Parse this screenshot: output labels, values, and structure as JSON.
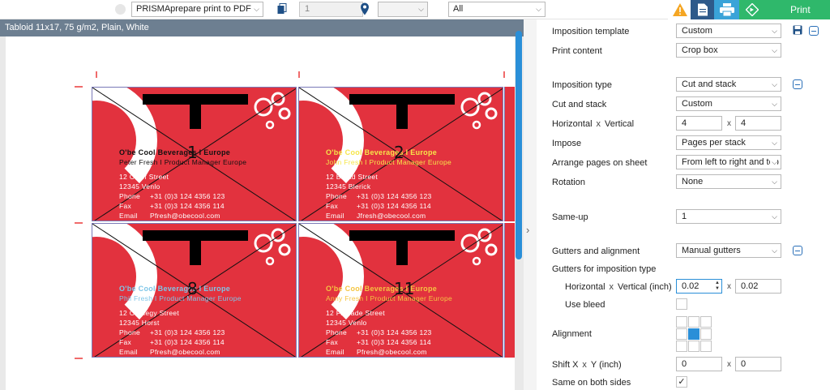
{
  "toolbar": {
    "printer_select": "PRISMAprepare print to PDF",
    "copies_value": "1",
    "location_select": "",
    "filter_select": "All",
    "print_label": "Print"
  },
  "preview": {
    "header": "Tabloid 11x17, 75 g/m2, Plain, White"
  },
  "cards": [
    {
      "num": "1",
      "company": "O'be Cool Beverages I Europe",
      "person": "Peter Fresh I Product Manager Europe",
      "addr1": "12 Cleef Street",
      "addr2": "12345 Venlo",
      "phone_k": "Phone",
      "phone_v": "+31 (0)3 124 4356 123",
      "fax_k": "Fax",
      "fax_v": "+31 (0)3 124 4356 114",
      "email_k": "Email",
      "email_v": "Pfresh@obecool.com",
      "company_color": "#111111",
      "person_color": "#111111"
    },
    {
      "num": "2",
      "company": "O'be Cool Beverages I Europe",
      "person": "John Fresh I Product Manager Europe",
      "addr1": "12 Broad Street",
      "addr2": "12345 Blerick",
      "phone_k": "Phone",
      "phone_v": "+31 (0)3 124 4356 123",
      "fax_k": "Fax",
      "fax_v": "+31 (0)3 124 4356 114",
      "email_k": "Email",
      "email_v": "Jfresh@obecool.com",
      "company_color": "#f6e64a",
      "person_color": "#f6e64a"
    },
    {
      "num": "8",
      "company": "O'be Cool Beverages I Europe",
      "person": "Phil Fresh I Product Manager Europe",
      "addr1": "12 Carnegy Street",
      "addr2": "12345 Horst",
      "phone_k": "Phone",
      "phone_v": "+31 (0)3 124 4356 123",
      "fax_k": "Fax",
      "fax_v": "+31 (0)3 124 4356 114",
      "email_k": "Email",
      "email_v": "Pfresh@obecool.com",
      "company_color": "#7fc6e8",
      "person_color": "#7fc6e8"
    },
    {
      "num": "11",
      "company": "O'be Cool Beverages I Europe",
      "person": "Anny Fresh I Product Manager Europe",
      "addr1": "12 Floriade Street",
      "addr2": "12345 Venlo",
      "phone_k": "Phone",
      "phone_v": "+31 (0)3 124 4356 123",
      "fax_k": "Fax",
      "fax_v": "+31 (0)3 124 4356 114",
      "email_k": "Email",
      "email_v": "Pfresh@obecool.com",
      "company_color": "#f5c542",
      "person_color": "#f5c542"
    }
  ],
  "panel": {
    "imposition_template_label": "Imposition template",
    "imposition_template_value": "Custom",
    "print_content_label": "Print content",
    "print_content_value": "Crop box",
    "imposition_type_label": "Imposition type",
    "imposition_type_value": "Cut and stack",
    "cut_and_stack_label": "Cut and stack",
    "cut_and_stack_value": "Custom",
    "horizontal_label": "Horizontal",
    "x_sep": "x",
    "vertical_label": "Vertical",
    "horizontal_value": "4",
    "vertical_value": "4",
    "impose_label": "Impose",
    "impose_value": "Pages per stack",
    "arrange_label": "Arrange pages on sheet",
    "arrange_value": "From left to right and top",
    "rotation_label": "Rotation",
    "rotation_value": "None",
    "same_up_label": "Same-up",
    "same_up_value": "1",
    "gutters_label": "Gutters and alignment",
    "gutters_value": "Manual gutters",
    "gutters_for_label": "Gutters for imposition type",
    "gutter_h_label": "Horizontal",
    "gutter_v_label": "Vertical (inch)",
    "gutter_h_value": "0.02",
    "gutter_v_value": "0.02",
    "use_bleed_label": "Use bleed",
    "alignment_label": "Alignment",
    "shift_x_label": "Shift X",
    "shift_y_label": "Y (inch)",
    "shift_x_value": "0",
    "shift_y_value": "0",
    "same_both_sides_label": "Same on both sides",
    "same_both_sides_check": "✓"
  },
  "colors": {
    "card_red": "#e2323e",
    "accent_blue": "#2a8fd8",
    "print_green": "#2fb86b",
    "header_gray": "#6d7f91"
  }
}
